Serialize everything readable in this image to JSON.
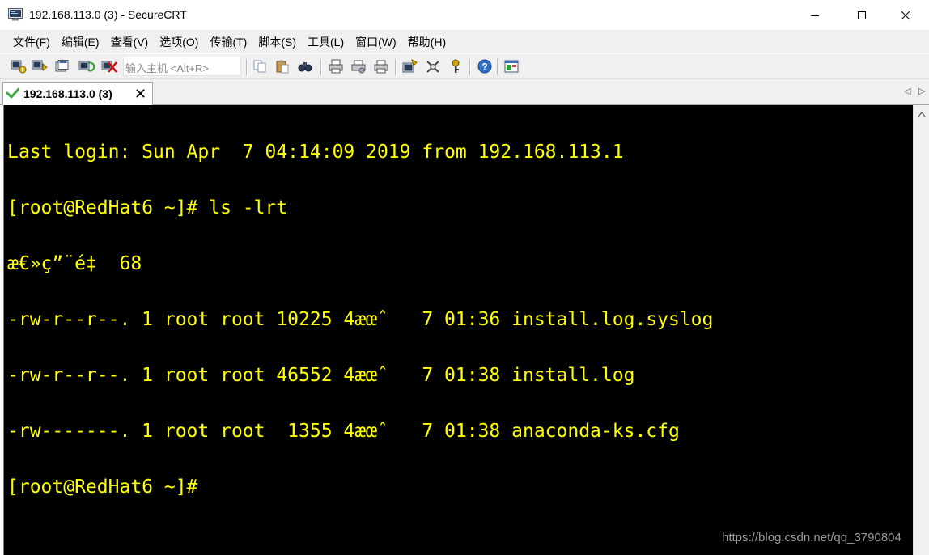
{
  "window": {
    "title": "192.168.113.0 (3) - SecureCRT",
    "app_icon": "securecrt-app-icon",
    "controls": {
      "minimize": "minimize-icon",
      "maximize": "maximize-icon",
      "close": "close-icon"
    }
  },
  "menu": {
    "items": [
      {
        "label": "文件(F)"
      },
      {
        "label": "编辑(E)"
      },
      {
        "label": "查看(V)"
      },
      {
        "label": "选项(O)"
      },
      {
        "label": "传输(T)"
      },
      {
        "label": "脚本(S)"
      },
      {
        "label": "工具(L)"
      },
      {
        "label": "窗口(W)"
      },
      {
        "label": "帮助(H)"
      }
    ]
  },
  "toolbar": {
    "quick_connect_placeholder": "输入主机 <Alt+R>",
    "icons": [
      "connect-icon",
      "quick-connect-icon",
      "connect-tab-icon",
      "reconnect-icon",
      "disconnect-icon",
      "copy-icon",
      "paste-icon",
      "find-icon",
      "print-icon",
      "print-setup-icon",
      "print-selection-icon",
      "session-options-icon",
      "global-options-icon",
      "keymap-icon",
      "help-icon",
      "sftp-icon"
    ]
  },
  "tabs": [
    {
      "label": "192.168.113.0 (3)",
      "status": "connected",
      "status_color": "#3fa83f"
    }
  ],
  "terminal": {
    "foreground": "#ffff00",
    "background": "#000000",
    "lines": [
      "Last login: Sun Apr  7 04:14:09 2019 from 192.168.113.1",
      "[root@RedHat6 ~]# ls -lrt",
      "æ€»ç”¨é‡  68",
      "-rw-r--r--. 1 root root 10225 4æœˆ   7 01:36 install.log.syslog",
      "-rw-r--r--. 1 root root 46552 4æœˆ   7 01:38 install.log",
      "-rw-------. 1 root root  1355 4æœˆ   7 01:38 anaconda-ks.cfg",
      "[root@RedHat6 ~]#"
    ]
  },
  "watermark": "https://blog.csdn.net/qq_3790804"
}
